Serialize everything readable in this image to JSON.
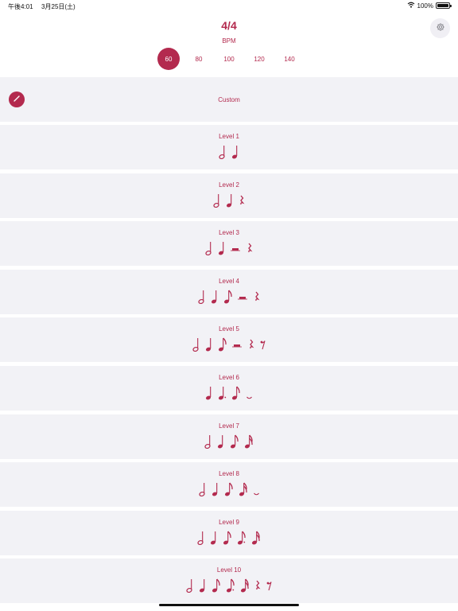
{
  "status_bar": {
    "time": "午後4:01",
    "date": "3月25日(土)",
    "wifi_icon": "wifi-icon",
    "battery": "100%",
    "battery_level": 1.0
  },
  "header": {
    "time_signature": "4/4",
    "bpm_label": "BPM",
    "bpm_options": [
      "60",
      "80",
      "100",
      "120",
      "140"
    ],
    "selected_bpm": "60",
    "settings_icon": "gear-icon"
  },
  "custom": {
    "label": "Custom",
    "edit_icon": "pencil-icon"
  },
  "levels": [
    {
      "label": "Level 1",
      "notes": [
        "half",
        "quarter"
      ]
    },
    {
      "label": "Level 2",
      "notes": [
        "half",
        "quarter",
        "quarter-rest"
      ]
    },
    {
      "label": "Level 3",
      "notes": [
        "half",
        "quarter",
        "half-rest",
        "quarter-rest"
      ]
    },
    {
      "label": "Level 4",
      "notes": [
        "half",
        "quarter",
        "eighth",
        "half-rest",
        "quarter-rest"
      ]
    },
    {
      "label": "Level 5",
      "notes": [
        "half",
        "quarter",
        "eighth",
        "half-rest",
        "quarter-rest",
        "eighth-rest"
      ]
    },
    {
      "label": "Level 6",
      "notes": [
        "quarter",
        "dotted-quarter",
        "eighth",
        "tie"
      ]
    },
    {
      "label": "Level 7",
      "notes": [
        "half",
        "quarter",
        "eighth",
        "sixteenth"
      ]
    },
    {
      "label": "Level 8",
      "notes": [
        "half",
        "quarter",
        "eighth",
        "sixteenth",
        "tie"
      ]
    },
    {
      "label": "Level 9",
      "notes": [
        "half",
        "quarter",
        "eighth",
        "dotted-eighth",
        "sixteenth"
      ]
    },
    {
      "label": "Level 10",
      "notes": [
        "half",
        "quarter",
        "eighth",
        "dotted-eighth",
        "sixteenth",
        "quarter-rest",
        "eighth-rest"
      ]
    }
  ],
  "colors": {
    "accent": "#b32a4e",
    "row_background": "#f2f2f6",
    "page_background": "#ffffff"
  }
}
